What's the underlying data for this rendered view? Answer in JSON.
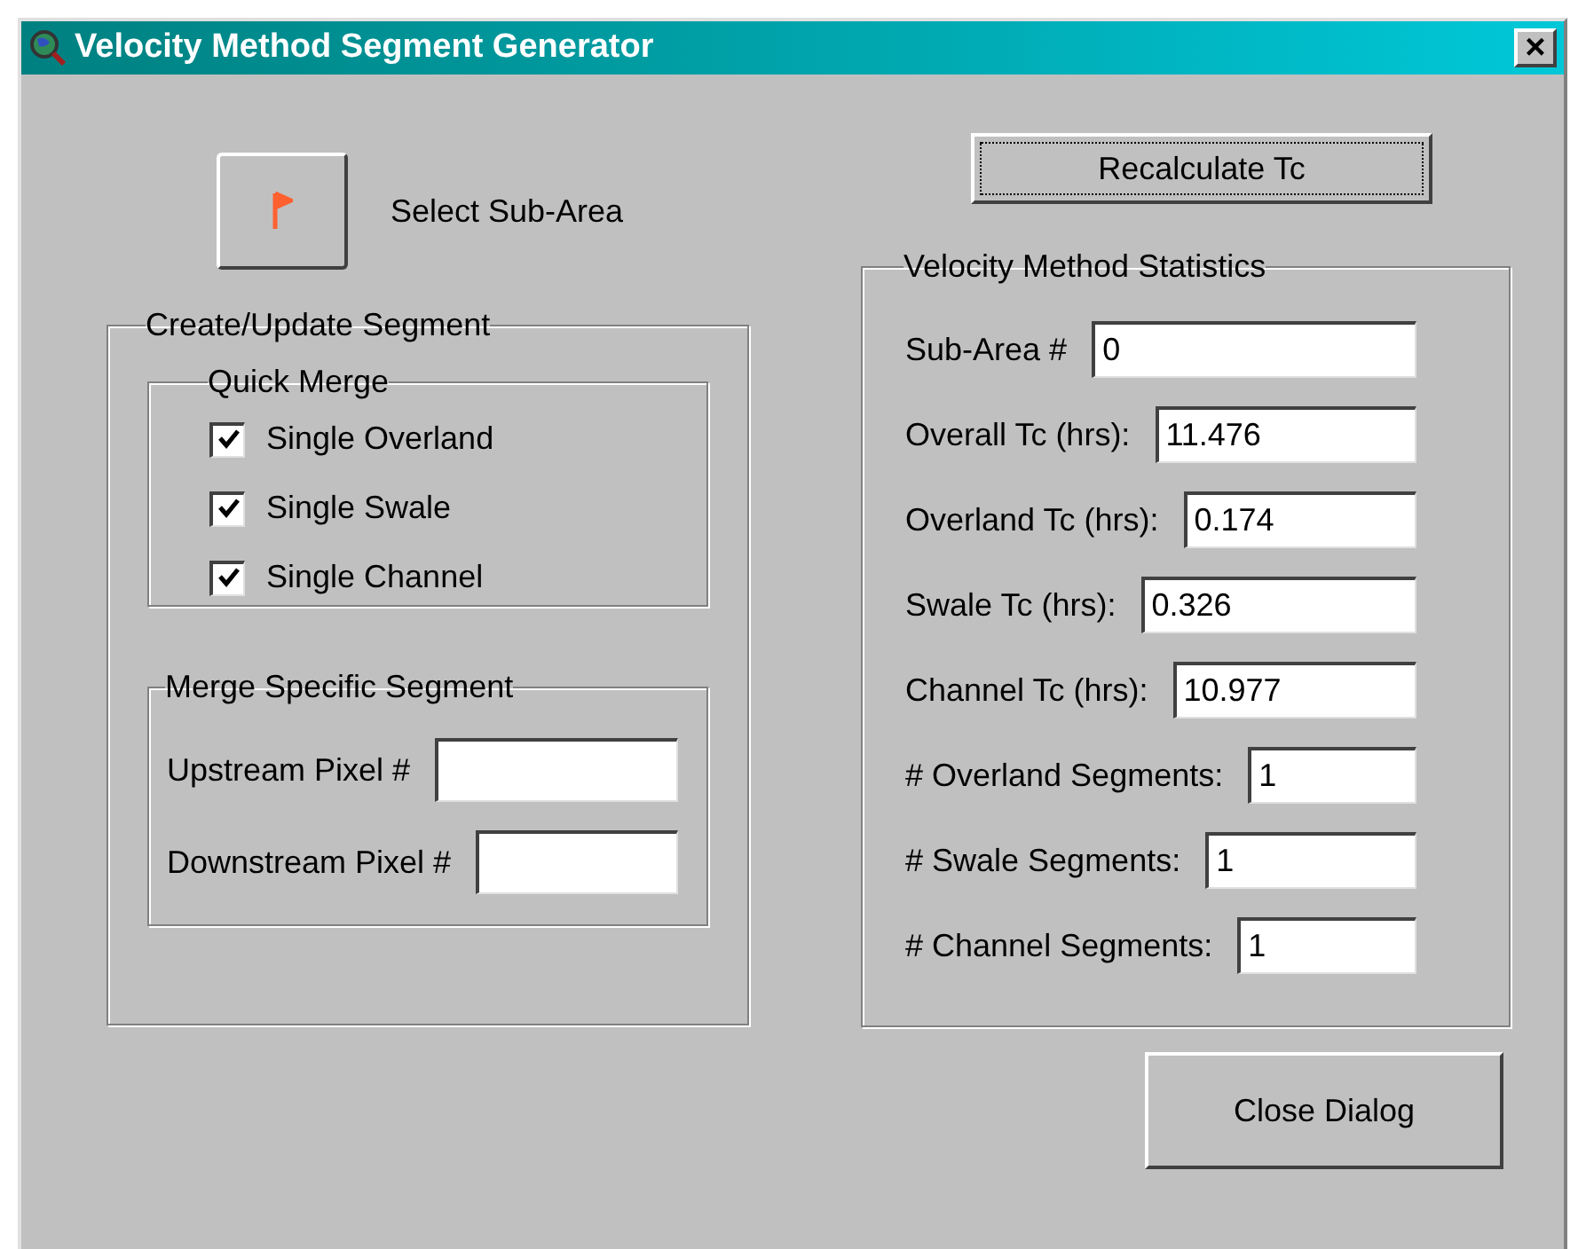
{
  "window": {
    "title": "Velocity Method Segment Generator",
    "close_label": "×"
  },
  "select_sub_area": {
    "label": "Select Sub-Area"
  },
  "recalculate_button": "Recalculate Tc",
  "create_update": {
    "title": "Create/Update Segment",
    "quick_merge": {
      "title": "Quick Merge",
      "options": [
        {
          "label": "Single Overland",
          "checked": true
        },
        {
          "label": "Single Swale",
          "checked": true
        },
        {
          "label": "Single Channel",
          "checked": true
        }
      ]
    },
    "merge_specific": {
      "title": "Merge Specific Segment",
      "fields": [
        {
          "label": "Upstream Pixel #"
        },
        {
          "label": "Downstream Pixel #"
        }
      ]
    }
  },
  "statistics": {
    "title": "Velocity Method Statistics",
    "fields": [
      {
        "label": "Sub-Area #",
        "value": "0"
      },
      {
        "label": "Overall Tc (hrs):",
        "value": "11.476"
      },
      {
        "label": "Overland Tc (hrs):",
        "value": "0.174"
      },
      {
        "label": "Swale Tc (hrs):",
        "value": "0.326"
      },
      {
        "label": "Channel Tc (hrs):",
        "value": "10.977"
      },
      {
        "label": "# Overland Segments:",
        "value": "1"
      },
      {
        "label": "# Swale Segments:",
        "value": "1"
      },
      {
        "label": "# Channel Segments:",
        "value": "1"
      }
    ]
  },
  "close_button": "Close Dialog"
}
